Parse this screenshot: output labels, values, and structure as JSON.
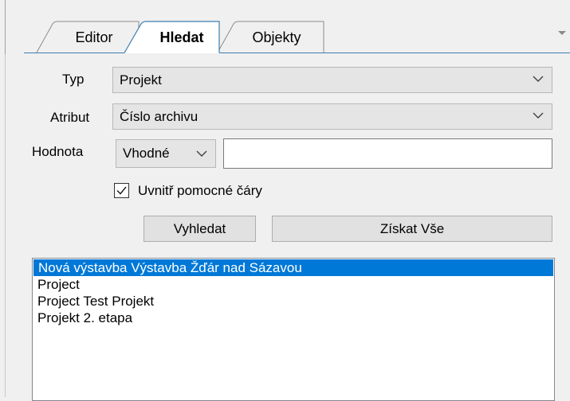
{
  "tabs": [
    {
      "label": "Editor",
      "active": false
    },
    {
      "label": "Hledat",
      "active": true
    },
    {
      "label": "Objekty",
      "active": false
    }
  ],
  "tab_menu_icon": "chevron-down-icon",
  "search": {
    "type_label": "Typ",
    "type_value": "Projekt",
    "attribute_label": "Atribut",
    "attribute_value": "Číslo archivu",
    "value_label": "Hodnota",
    "match_value": "Vhodné",
    "value_text": "",
    "inside_helper_lines_label": "Uvnitř pomocné čáry",
    "inside_helper_lines_checked": true,
    "search_button": "Vyhledat",
    "get_all_button": "Získat Vše"
  },
  "results": [
    {
      "text": "Nová výstavba Výstavba Žďár nad Sázavou",
      "selected": true
    },
    {
      "text": "Project",
      "selected": false
    },
    {
      "text": "Project Test Projekt",
      "selected": false
    },
    {
      "text": "Projekt 2. etapa",
      "selected": false
    }
  ],
  "colors": {
    "selection": "#0078d7",
    "tab_border": "#3c7fb1",
    "background": "#f0f0f0"
  }
}
